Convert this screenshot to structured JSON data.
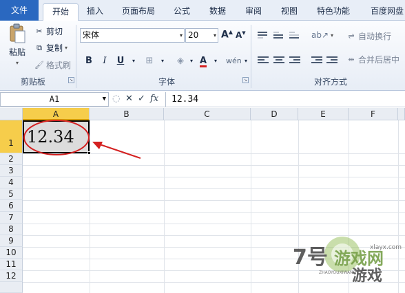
{
  "tabs": [
    {
      "label": "文件"
    },
    {
      "label": "开始"
    },
    {
      "label": "插入"
    },
    {
      "label": "页面布局"
    },
    {
      "label": "公式"
    },
    {
      "label": "数据"
    },
    {
      "label": "审阅"
    },
    {
      "label": "视图"
    },
    {
      "label": "特色功能"
    },
    {
      "label": "百度网盘"
    }
  ],
  "ribbon": {
    "clipboard": {
      "paste": "粘贴",
      "cut": "剪切",
      "copy": "复制",
      "format_painter": "格式刷",
      "group": "剪贴板"
    },
    "font": {
      "name": "宋体",
      "size": "20",
      "group": "字体"
    },
    "alignment": {
      "wrap": "自动换行",
      "merge": "合并后居中",
      "group": "对齐方式"
    }
  },
  "formula_bar": {
    "name_box": "A1",
    "content": "12.34"
  },
  "columns": [
    "A",
    "B",
    "C",
    "D",
    "E",
    "F"
  ],
  "rows": [
    "1",
    "2",
    "3",
    "4",
    "5",
    "6",
    "7",
    "8",
    "9",
    "10",
    "11",
    "12"
  ],
  "cell_a1": "12.34",
  "watermark": {
    "brand": "7号游戏网",
    "sub": "ZHAOYOUXIWANG",
    "game": "游戏",
    "url": "xlayx.com"
  },
  "colors": {
    "file_tab": "#2a68c0",
    "selected_header": "#f6cd4b",
    "annotation": "#d42020"
  }
}
